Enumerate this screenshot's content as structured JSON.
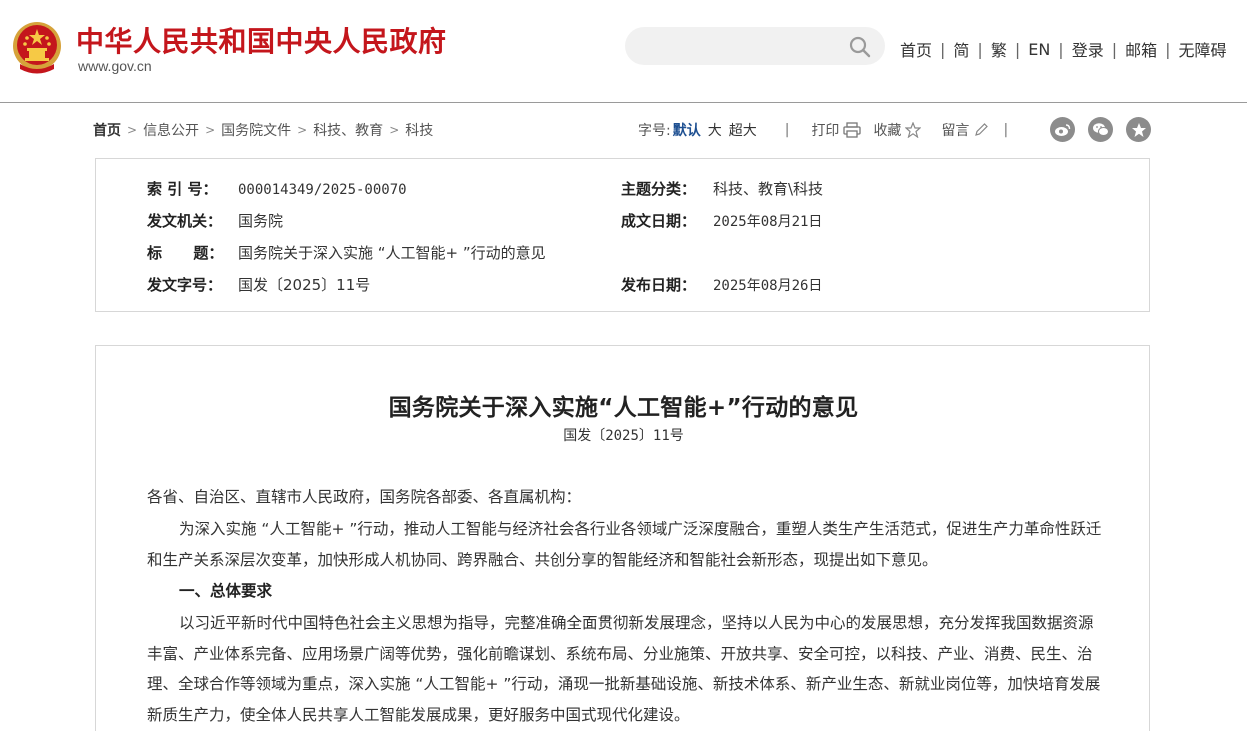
{
  "header": {
    "site_title": "中华人民共和国中央人民政府",
    "site_domain": "www.gov.cn",
    "search_placeholder": "",
    "nav": [
      "首页",
      "简",
      "繁",
      "EN",
      "登录",
      "邮箱",
      "无障碍"
    ],
    "nav_separator": "|"
  },
  "breadcrumb": {
    "items": [
      "首页",
      "信息公开",
      "国务院文件",
      "科技、教育",
      "科技"
    ],
    "arrow": ">"
  },
  "tools": {
    "font_size_label": "字号:",
    "font_default": "默认",
    "font_large": "大",
    "font_xlarge": "超大",
    "separator": "|",
    "print": "打印",
    "favorite": "收藏",
    "comment": "留言"
  },
  "meta": {
    "index_label": "索 引 号：",
    "index_value": "000014349/2025-00070",
    "category_label": "主题分类：",
    "category_value": "科技、教育\\科技",
    "issuer_label": "发文机关：",
    "issuer_value": "国务院",
    "created_label": "成文日期：",
    "created_value": "2025年08月21日",
    "title_label": "标      题：",
    "title_value": "国务院关于深入实施 “人工智能+ ”行动的意见",
    "docno_label": "发文字号：",
    "docno_value": "国发〔2025〕11号",
    "published_label": "发布日期：",
    "published_value": "2025年08月26日"
  },
  "article": {
    "title": "国务院关于深入实施“人工智能+”行动的意见",
    "doc_number": "国发〔2025〕11号",
    "salutation": "各省、自治区、直辖市人民政府，国务院各部委、各直属机构：",
    "para1": "为深入实施 “人工智能+ ”行动，推动人工智能与经济社会各行业各领域广泛深度融合，重塑人类生产生活范式，促进生产力革命性跃迁和生产关系深层次变革，加快形成人机协同、跨界融合、共创分享的智能经济和智能社会新形态，现提出如下意见。",
    "heading1": "一、总体要求",
    "para2": "以习近平新时代中国特色社会主义思想为指导，完整准确全面贯彻新发展理念，坚持以人民为中心的发展思想，充分发挥我国数据资源丰富、产业体系完备、应用场景广阔等优势，强化前瞻谋划、系统布局、分业施策、开放共享、安全可控，以科技、产业、消费、民生、治理、全球合作等领域为重点，深入实施 “人工智能+ ”行动，涌现一批新基础设施、新技术体系、新产业生态、新就业岗位等，加快培育发展新质生产力，使全体人民共享人工智能发展成果，更好服务中国式现代化建设。"
  },
  "colors": {
    "brand_red": "#c4161c",
    "link_blue": "#1d4f91",
    "icon_gray": "#8c8c8c"
  }
}
